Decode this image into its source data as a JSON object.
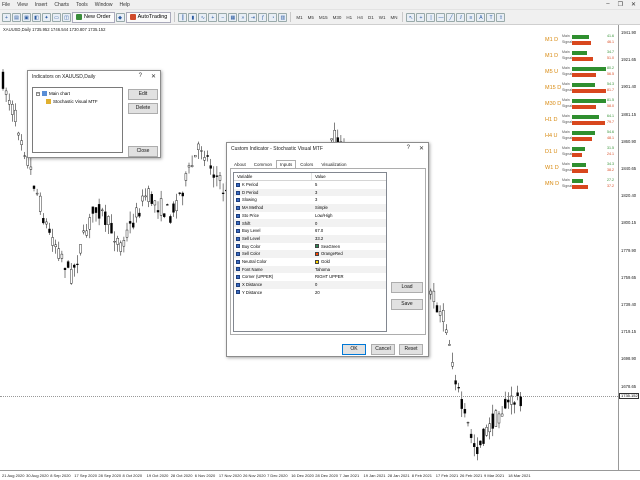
{
  "menu": {
    "items": [
      "File",
      "View",
      "Insert",
      "Charts",
      "Tools",
      "Window",
      "Help"
    ]
  },
  "toolbar": {
    "new_order": "New Order",
    "autotrading": "AutoTrading",
    "timeframes": [
      "M1",
      "M5",
      "M15",
      "M30",
      "H1",
      "H4",
      "D1",
      "W1",
      "MN"
    ]
  },
  "chart": {
    "info": "XAUUSD,Daily  1735.952 1746.544 1730.807 1735.152",
    "price_labels": [
      "1941.90",
      "1921.65",
      "1901.40",
      "1881.15",
      "1860.90",
      "1840.65",
      "1820.40",
      "1800.15",
      "1779.90",
      "1759.65",
      "1739.40",
      "1719.15",
      "1698.90",
      "1678.65"
    ],
    "current_price": "1735.152",
    "time_labels": [
      "21 Aug 2020",
      "30 Aug 2020",
      "8 Sep 2020",
      "17 Sep 2020",
      "28 Sep 2020",
      "8 Oct 2020",
      "19 Oct 2020",
      "28 Oct 2020",
      "6 Nov 2020",
      "17 Nov 2020",
      "26 Nov 2020",
      "7 Dec 2020",
      "16 Dec 2020",
      "28 Dec 2020",
      "7 Jan 2021",
      "19 Jan 2021",
      "28 Jan 2021",
      "8 Feb 2021",
      "17 Feb 2021",
      "26 Feb 2021",
      "9 Mar 2021",
      "18 Mar 2021"
    ],
    "colors": {
      "bull": "#ffffff",
      "bear": "#000000",
      "wick": "#000000"
    }
  },
  "mtf_panel": {
    "colors": {
      "main": "#2f8f2f",
      "signal": "#d8471e",
      "label": "#d88a10"
    },
    "rows": [
      {
        "tf": "M1 D",
        "main": 41.6,
        "signal": 46.1
      },
      {
        "tf": "M1 D",
        "main": 34.7,
        "signal": 51.0
      },
      {
        "tf": "M5 U",
        "main": 80.2,
        "signal": 56.5
      },
      {
        "tf": "M15 D",
        "main": 54.3,
        "signal": 81.7
      },
      {
        "tf": "M30 D",
        "main": 81.5,
        "signal": 58.0
      },
      {
        "tf": "H1 D",
        "main": 64.1,
        "signal": 79.7
      },
      {
        "tf": "H4 U",
        "main": 54.6,
        "signal": 48.1
      },
      {
        "tf": "D1 U",
        "main": 31.5,
        "signal": 24.1
      },
      {
        "tf": "W1 D",
        "main": 34.3,
        "signal": 38.2
      },
      {
        "tf": "MN D",
        "main": 27.2,
        "signal": 37.2
      }
    ],
    "main_label": "Main",
    "signal_label": "Signal"
  },
  "indicators_dialog": {
    "title": "Indicators on XAUUSD,Daily",
    "tree_root": "Main chart",
    "tree_child": "Stochastic Visual MTF",
    "edit": "Edit",
    "delete": "Delete",
    "close": "Close",
    "help": "?",
    "close_x": "✕"
  },
  "custom_indicator_dialog": {
    "title": "Custom Indicator - Stochastic Visual MTF",
    "tabs": [
      "About",
      "Common",
      "Inputs",
      "Colors",
      "Visualization"
    ],
    "active_tab": "Inputs",
    "columns": [
      "Variable",
      "Value"
    ],
    "rows": [
      {
        "variable": "K Period",
        "value": "5"
      },
      {
        "variable": "D Period",
        "value": "3"
      },
      {
        "variable": "Slowing",
        "value": "3"
      },
      {
        "variable": "MA Method",
        "value": "Simple"
      },
      {
        "variable": "Sto Price",
        "value": "Low/High"
      },
      {
        "variable": "Shift",
        "value": "0"
      },
      {
        "variable": "Buy Level",
        "value": "67.0"
      },
      {
        "variable": "Sell Level",
        "value": "33.2"
      },
      {
        "variable": "Buy Color",
        "value": "SeaGreen",
        "swatch": "#2e8b57"
      },
      {
        "variable": "Sell Color",
        "value": "OrangeRed",
        "swatch": "#ff4500"
      },
      {
        "variable": "Neutral Color",
        "value": "Gold",
        "swatch": "#ffd700"
      },
      {
        "variable": "Font Name",
        "value": "Tahoma"
      },
      {
        "variable": "Corner (UPPER)",
        "value": "RIGHT UPPER"
      },
      {
        "variable": "X Distance",
        "value": "0"
      },
      {
        "variable": "Y Distance",
        "value": "20"
      }
    ],
    "load": "Load",
    "save": "Save",
    "ok": "OK",
    "cancel": "Cancel",
    "reset": "Reset",
    "help": "?",
    "close_x": "✕"
  }
}
